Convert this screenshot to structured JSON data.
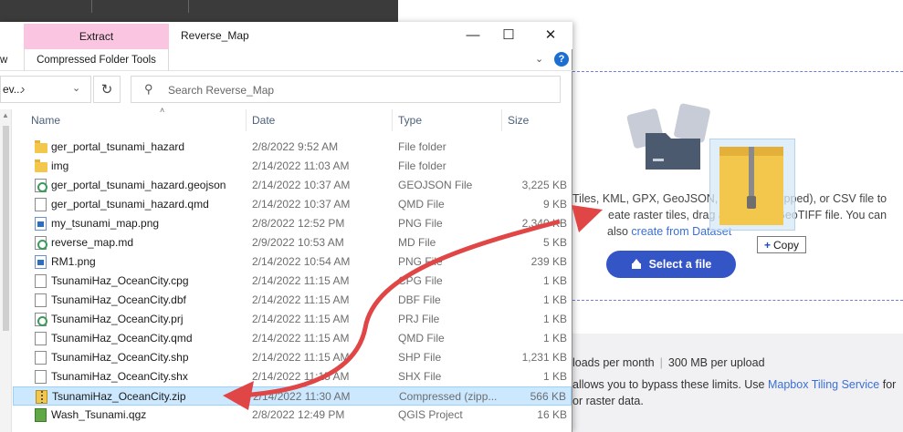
{
  "explorer": {
    "ribbon_tab": "Extract",
    "ribbon_group": "Compressed Folder Tools",
    "ribbon_left_fragment": "w",
    "title": "Reverse_Map",
    "address_fragment": "ev...",
    "search_placeholder": "Search Reverse_Map",
    "columns": {
      "name": "Name",
      "date": "Date",
      "type": "Type",
      "size": "Size"
    },
    "files": [
      {
        "name": "ger_portal_tsunami_hazard",
        "date": "2/8/2022 9:52 AM",
        "type": "File folder",
        "size": "",
        "icon": "folder-icon"
      },
      {
        "name": "img",
        "date": "2/14/2022 11:03 AM",
        "type": "File folder",
        "size": "",
        "icon": "folder-icon"
      },
      {
        "name": "ger_portal_tsunami_hazard.geojson",
        "date": "2/14/2022 10:37 AM",
        "type": "GEOJSON File",
        "size": "3,225 KB",
        "icon": "geojson-file-icon"
      },
      {
        "name": "ger_portal_tsunami_hazard.qmd",
        "date": "2/14/2022 10:37 AM",
        "type": "QMD File",
        "size": "9 KB",
        "icon": "document-icon"
      },
      {
        "name": "my_tsunami_map.png",
        "date": "2/8/2022 12:52 PM",
        "type": "PNG File",
        "size": "2,340 KB",
        "icon": "png-file-icon"
      },
      {
        "name": "reverse_map.md",
        "date": "2/9/2022 10:53 AM",
        "type": "MD File",
        "size": "5 KB",
        "icon": "geojson-file-icon"
      },
      {
        "name": "RM1.png",
        "date": "2/14/2022 10:54 AM",
        "type": "PNG File",
        "size": "239 KB",
        "icon": "png-file-icon"
      },
      {
        "name": "TsunamiHaz_OceanCity.cpg",
        "date": "2/14/2022 11:15 AM",
        "type": "CPG File",
        "size": "1 KB",
        "icon": "document-icon"
      },
      {
        "name": "TsunamiHaz_OceanCity.dbf",
        "date": "2/14/2022 11:15 AM",
        "type": "DBF File",
        "size": "1 KB",
        "icon": "document-icon"
      },
      {
        "name": "TsunamiHaz_OceanCity.prj",
        "date": "2/14/2022 11:15 AM",
        "type": "PRJ File",
        "size": "1 KB",
        "icon": "geojson-file-icon"
      },
      {
        "name": "TsunamiHaz_OceanCity.qmd",
        "date": "2/14/2022 11:15 AM",
        "type": "QMD File",
        "size": "1 KB",
        "icon": "document-icon"
      },
      {
        "name": "TsunamiHaz_OceanCity.shp",
        "date": "2/14/2022 11:15 AM",
        "type": "SHP File",
        "size": "1,231 KB",
        "icon": "document-icon"
      },
      {
        "name": "TsunamiHaz_OceanCity.shx",
        "date": "2/14/2022 11:15 AM",
        "type": "SHX File",
        "size": "1 KB",
        "icon": "document-icon"
      },
      {
        "name": "TsunamiHaz_OceanCity.zip",
        "date": "2/14/2022 11:30 AM",
        "type": "Compressed (zipp...",
        "size": "566 KB",
        "icon": "zip-file-icon",
        "selected": true
      },
      {
        "name": "Wash_Tsunami.qgz",
        "date": "2/8/2022 12:49 PM",
        "type": "QGIS Project",
        "size": "16 KB",
        "icon": "qgis-file-icon"
      }
    ]
  },
  "webpage": {
    "upload_line1": "Tiles, KML, GPX, GeoJSON, Shapefile (zipped), or CSV file to",
    "upload_line2": "eate raster tiles, drag and drop a GeoTIFF file. You can",
    "upload_line3_prefix": "also ",
    "upload_line3_link": "create from Dataset",
    "select_button": "Select a file",
    "copy_tooltip": "Copy",
    "limits_line": "loads per month",
    "limits_separator": "|",
    "limits_size": "300 MB per upload",
    "bypass_prefix": "allows you to bypass these limits. Use ",
    "bypass_link": "Mapbox Tiling Service",
    "bypass_suffix": " for",
    "raster_line": "or raster data."
  },
  "colors": {
    "accent_button": "#3455c6",
    "link": "#3a6fd8",
    "selection": "#cce8ff",
    "ribbon_tab": "#f9c5e1",
    "arrow": "#e04646"
  }
}
